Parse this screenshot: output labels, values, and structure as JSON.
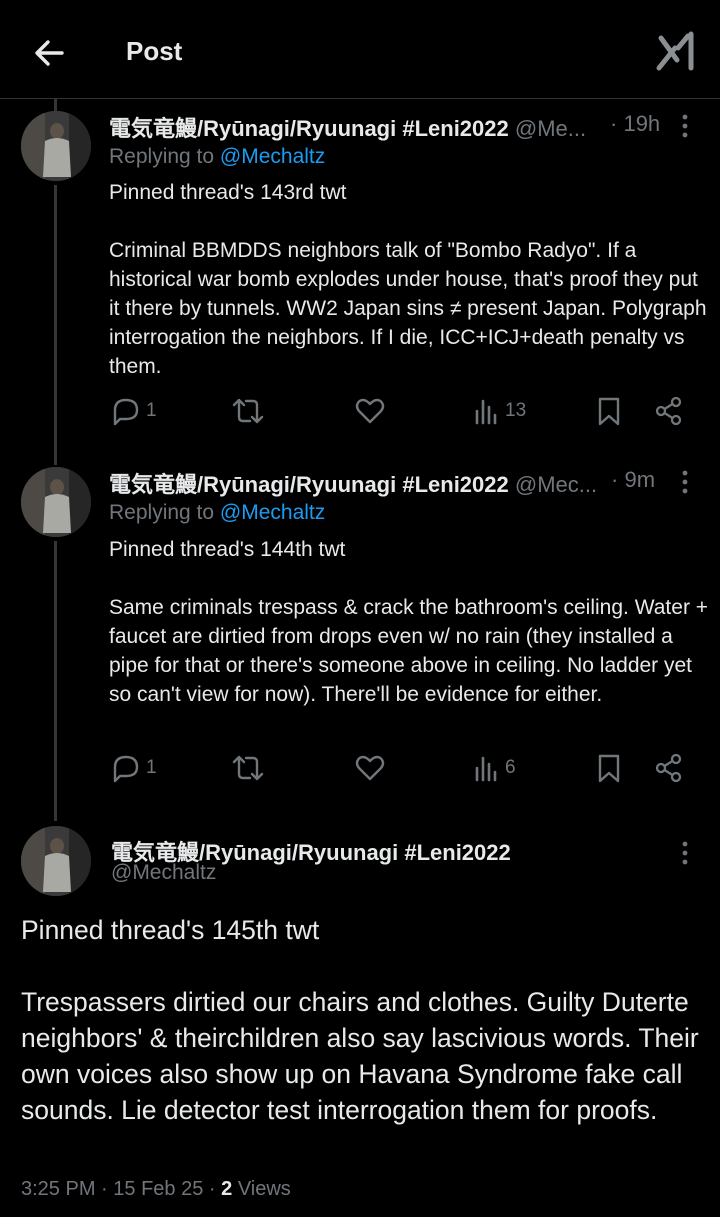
{
  "header": {
    "title": "Post",
    "back_icon": "arrow-left-icon",
    "logo_icon": "grok-x-logo-icon"
  },
  "tweets": [
    {
      "display_name": "電気竜鰻/Ryūnagi/Ryuunagi #Leni2022",
      "handle": "@Me...",
      "time": "19h",
      "replying_prefix": "Replying to",
      "replying_to": "@Mechaltz",
      "text": "Pinned thread's 143rd twt\n\nCriminal BBMDDS neighbors talk of \"Bombo Radyo\". If a historical war bomb explodes under house, that's proof they put it there by tunnels. WW2 Japan sins ≠ present Japan. Polygraph interrogation the neighbors. If I die, ICC+ICJ+death penalty vs them.",
      "replies": "1",
      "views": "13"
    },
    {
      "display_name": "電気竜鰻/Ryūnagi/Ryuunagi #Leni2022",
      "handle": "@Mec...",
      "time": "9m",
      "replying_prefix": "Replying to",
      "replying_to": "@Mechaltz",
      "text": "Pinned thread's 144th twt\n\nSame criminals trespass & crack the bathroom's ceiling. Water + faucet are dirtied from drops even w/ no rain (they installed a pipe for that or there's someone above in ceiling. No ladder yet so can't view for now). There'll be evidence for either.",
      "replies": "1",
      "views": "6"
    }
  ],
  "main_post": {
    "display_name": "電気竜鰻/Ryūnagi/Ryuunagi #Leni2022",
    "handle": "@Mechaltz",
    "text": "Pinned thread's 145th twt\n\nTrespassers dirtied our chairs and clothes. Guilty Duterte neighbors' & theirchildren also say lascivious words. Their own voices also show up on Havana Syndrome fake call sounds. Lie detector test interrogation them for proofs.",
    "time": "3:25 PM",
    "date": "15 Feb 25",
    "views_count": "2",
    "views_label": "Views"
  },
  "colors": {
    "background": "#000000",
    "text": "#e7e9ea",
    "muted": "#71767b",
    "link": "#1d9bf0",
    "divider": "#2f3336"
  }
}
